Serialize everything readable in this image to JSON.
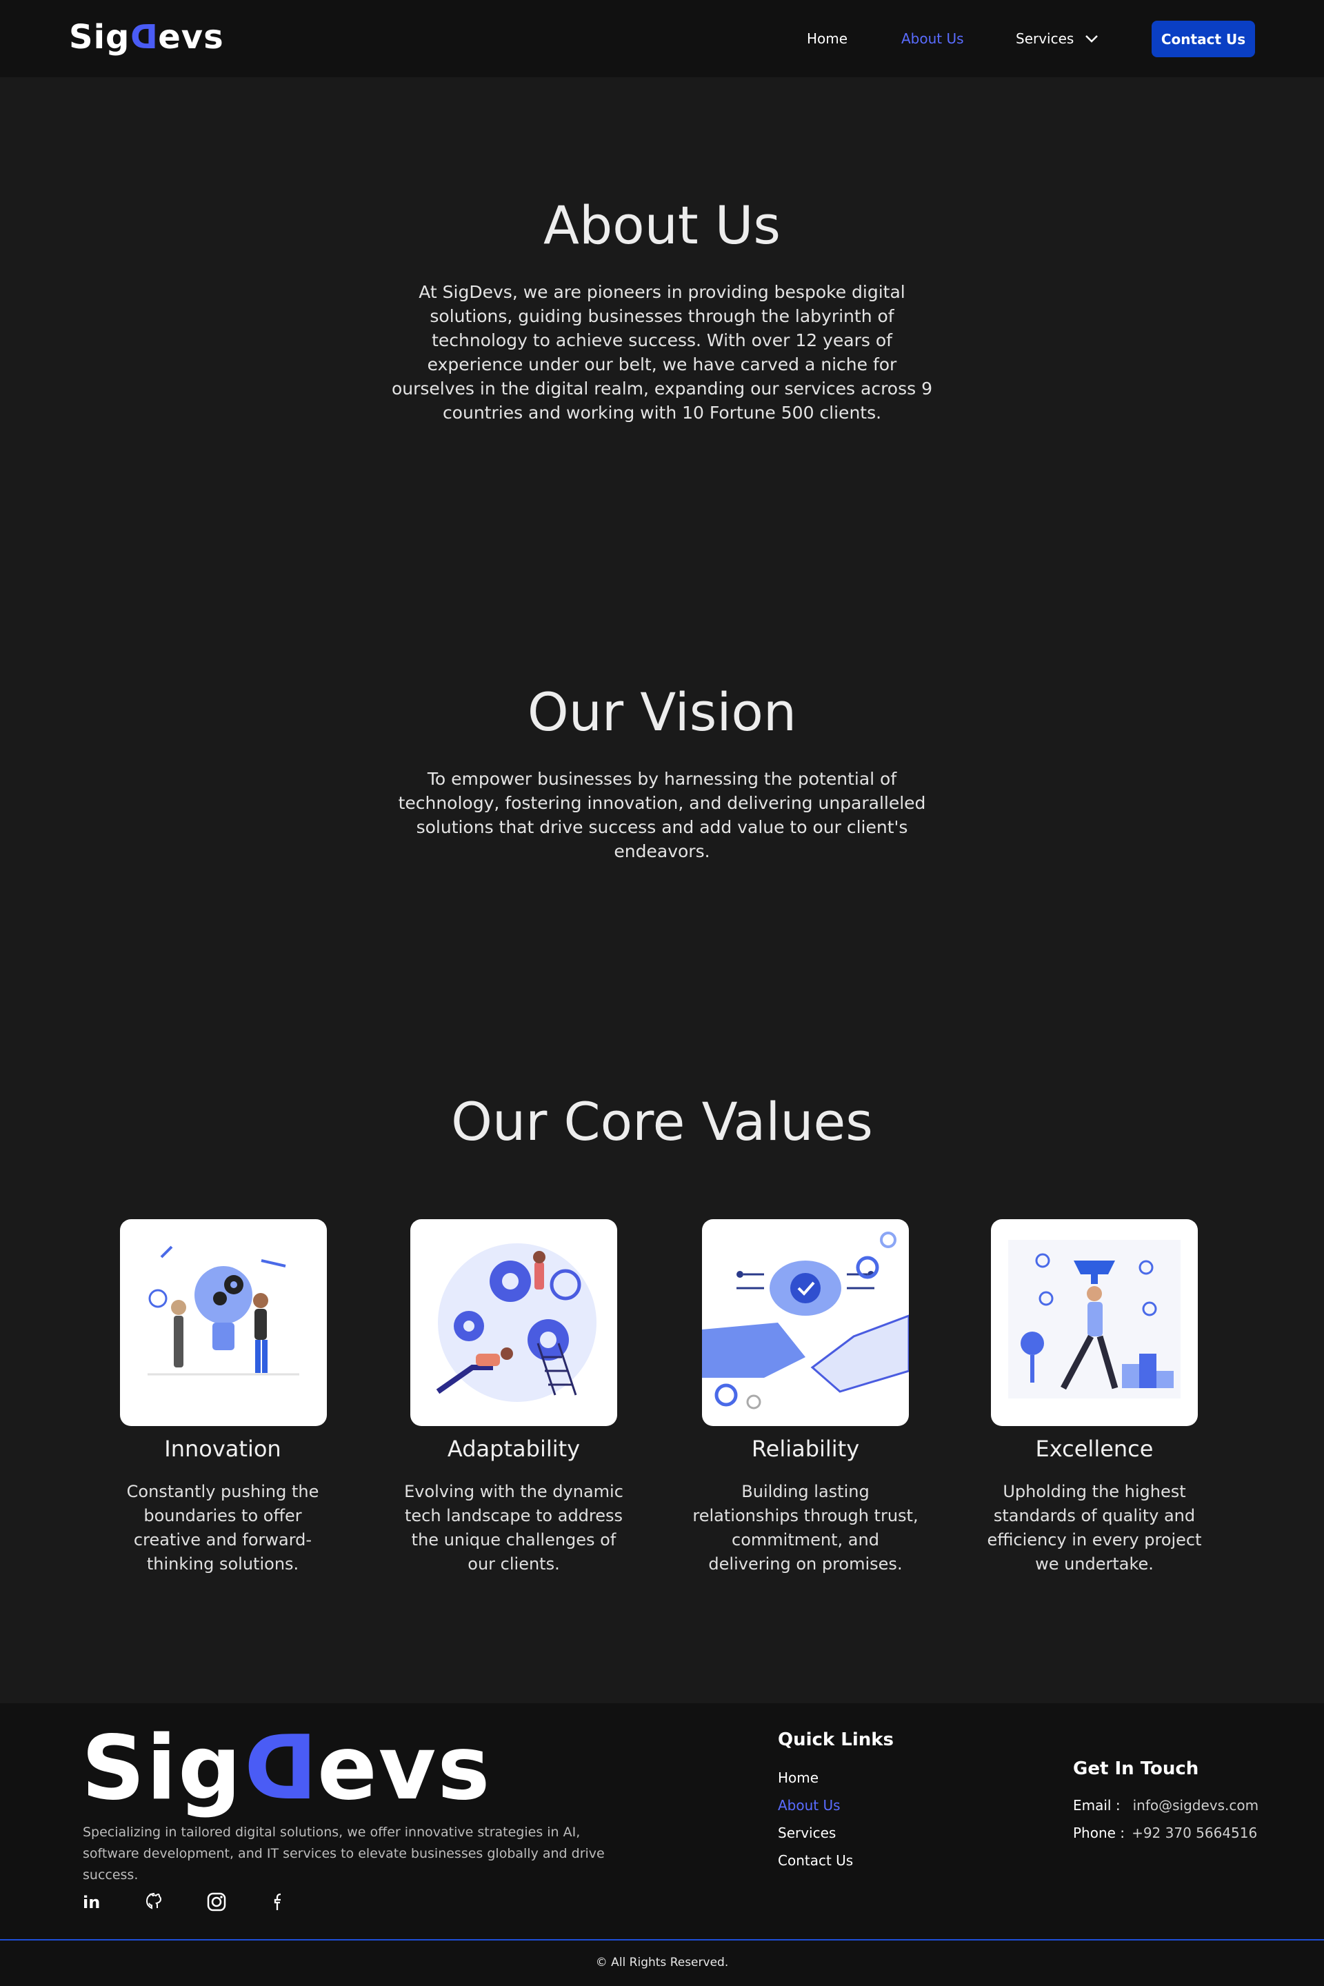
{
  "header": {
    "logo": {
      "part1": "Sig",
      "part2": "D",
      "part3": "evs"
    },
    "nav": {
      "home": "Home",
      "about": "About Us",
      "services": "Services",
      "services_icon": "chevron-down-icon"
    },
    "contact_button": "Contact Us",
    "accent_color": "#5a6cff",
    "button_color": "#0a3fc4"
  },
  "about": {
    "title": "About Us",
    "text": "At SigDevs, we are pioneers in providing bespoke digital solutions, guiding businesses through the labyrinth of technology to achieve success. With over 12 years of experience under our belt, we have carved a niche for ourselves in the digital realm, expanding our services across 9 countries and working with 10 Fortune 500 clients."
  },
  "vision": {
    "title": "Our Vision",
    "text": "To empower businesses by harnessing the potential of technology, fostering innovation, and delivering unparalleled solutions that drive success and add value to our client's endeavors."
  },
  "core_values": {
    "title": "Our Core Values",
    "items": [
      {
        "name": "Innovation",
        "description": "Constantly pushing the boundaries to offer creative and forward-thinking solutions.",
        "illustration": "lightbulb-gears-illustration"
      },
      {
        "name": "Adaptability",
        "description": "Evolving with the dynamic tech landscape to address the unique challenges of our clients.",
        "illustration": "people-gears-illustration"
      },
      {
        "name": "Reliability",
        "description": "Building lasting relationships through trust, commitment, and delivering on promises.",
        "illustration": "handshake-brain-illustration"
      },
      {
        "name": "Excellence",
        "description": "Upholding the highest standards of quality and efficiency in every project we undertake.",
        "illustration": "trophy-podium-illustration"
      }
    ]
  },
  "footer": {
    "logo": {
      "part1": "Sig",
      "part2": "D",
      "part3": "evs"
    },
    "tagline": "Specializing in tailored digital solutions, we offer innovative strategies in AI, software development, and IT services to elevate businesses globally and drive success.",
    "social_icons": [
      "linkedin-icon",
      "github-icon",
      "instagram-icon",
      "facebook-icon"
    ],
    "quick_links": {
      "title": "Quick Links",
      "links": [
        "Home",
        "About Us",
        "Services",
        "Contact Us"
      ]
    },
    "get_in_touch": {
      "title": "Get In Touch",
      "email_label": "Email :",
      "email": "info@sigdevs.com",
      "phone_label": "Phone :",
      "phone": "+92 370 5664516"
    },
    "copyright": "© All Rights Reserved."
  }
}
